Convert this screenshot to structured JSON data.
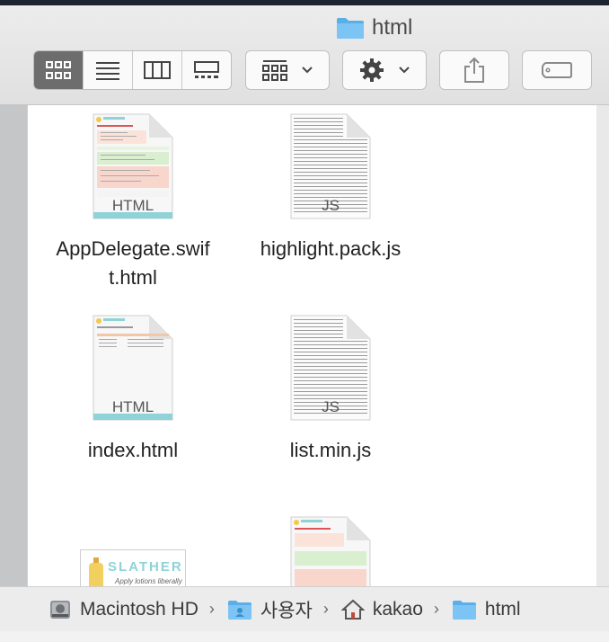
{
  "window": {
    "title": "html"
  },
  "toolbar": {
    "view_modes": [
      "icon-view",
      "list-view",
      "column-view",
      "gallery-view"
    ],
    "selected_view": "icon-view"
  },
  "files": [
    {
      "name": "AppDelegate.swift.html",
      "label_line1": "AppDelegate.swif",
      "label_line2": "t.html",
      "type_badge": "HTML",
      "kind": "html"
    },
    {
      "name": "highlight.pack.js",
      "label_line1": "highlight.pack.js",
      "type_badge": "JS",
      "kind": "js"
    },
    {
      "name": "index.html",
      "label_line1": "index.html",
      "type_badge": "HTML",
      "kind": "html"
    },
    {
      "name": "list.min.js",
      "label_line1": "list.min.js",
      "type_badge": "JS",
      "kind": "js"
    }
  ],
  "thumbs": {
    "slather_brand": "SLATHER",
    "slather_tagline": "Apply lotions liberally"
  },
  "pathbar": {
    "crumbs": [
      "Macintosh HD",
      "사용자",
      "kakao",
      "html"
    ]
  },
  "colors": {
    "folder_blue": "#6cb7f0",
    "selected_segment": "#6d6d6d",
    "teal_footer": "#8fd3d8"
  }
}
